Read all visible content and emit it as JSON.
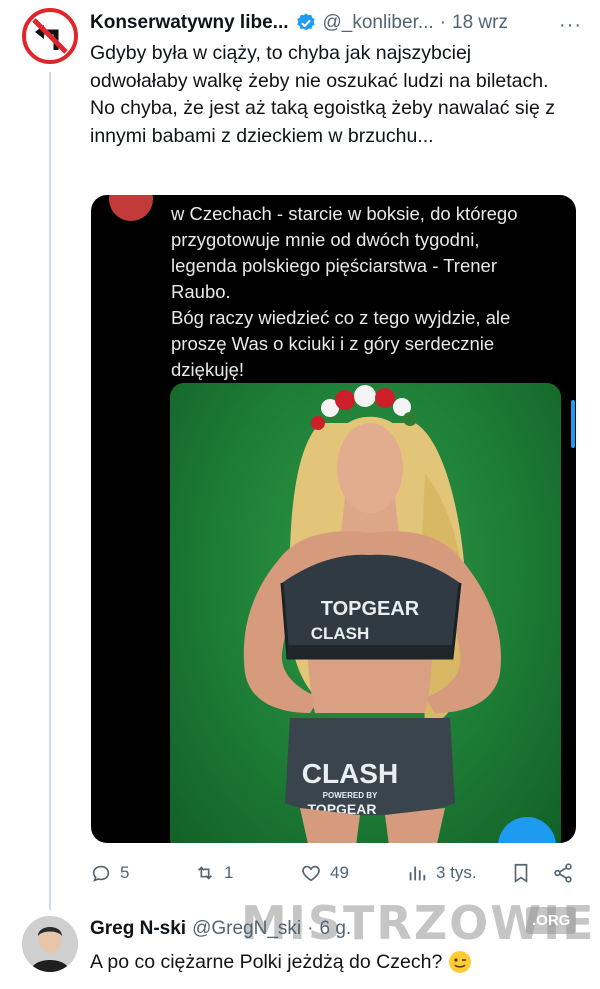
{
  "tweet": {
    "author_name": "Konserwatywny libe...",
    "handle": "@_konliber...",
    "separator": "·",
    "time": "18 wrz",
    "more": "···",
    "text": "Gdyby była w ciąży, to chyba jak najszybciej odwołałaby walkę żeby nie oszukać ludzi na biletach. No chyba, że jest aż taką egoistką żeby nawalać się z innymi babami z dzieckiem w brzuchu..."
  },
  "quote": {
    "text_lines": [
      "w Czechach - starcie w boksie, do którego",
      "przygotowuje mnie od dwóch tygodni,",
      "legenda polskiego pięściarstwa - Trener",
      "Raubo.",
      "Bóg raczy wiedzieć co z tego wyjdzie, ale",
      "proszę Was o kciuki i z góry serdecznie",
      "dziękuję!"
    ],
    "top_brand": "TOPGEAR",
    "top_logo": "CLASH",
    "skirt_logo": "CLASH",
    "skirt_powered": "POWERED BY",
    "skirt_brand": "TOPGEAR"
  },
  "actions": {
    "replies": "5",
    "reposts": "1",
    "likes": "49",
    "views": "3 tys."
  },
  "reply": {
    "author_name": "Greg N-ski",
    "handle": "@GregN_ski",
    "separator": "·",
    "time": "6 g.",
    "text": "A po co ciężarne Polki jeżdżą do Czech?"
  },
  "watermark": {
    "text": "MISTRZOWIE",
    "suffix": ".ORG"
  },
  "colors": {
    "accent": "#1d9bf0",
    "muted": "#536471",
    "avatar_ring": "#e0262a"
  }
}
